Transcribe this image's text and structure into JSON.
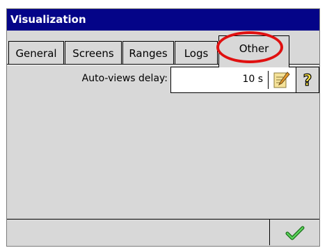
{
  "window": {
    "title": "Visualization"
  },
  "tabs": [
    {
      "label": "General",
      "active": false
    },
    {
      "label": "Screens",
      "active": false
    },
    {
      "label": "Ranges",
      "active": false
    },
    {
      "label": "Logs",
      "active": false
    },
    {
      "label": "Other",
      "active": true
    }
  ],
  "other_tab": {
    "auto_views_delay_label": "Auto-views delay:",
    "auto_views_delay_value": "10 s",
    "edit_icon": "notepad-pencil-icon",
    "help_icon": "question-mark-icon"
  },
  "statusbar": {
    "ok_icon": "green-checkmark-icon"
  },
  "annotation": {
    "highlight_color": "#e01010"
  },
  "colors": {
    "titlebar": "#040488",
    "panel": "#d8d8d8"
  }
}
